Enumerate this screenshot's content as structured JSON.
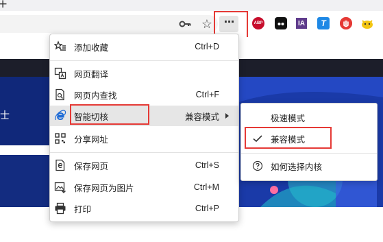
{
  "tabs": {
    "new_tab_glyph": "+"
  },
  "toolbar": {
    "icons": [
      "key-icon",
      "star-icon",
      "more-icon"
    ],
    "more_glyph": "···",
    "extensions": [
      {
        "name": "adblock-plus-icon",
        "text": "ABP"
      },
      {
        "name": "dots-extension-icon",
        "text": ""
      },
      {
        "name": "internet-archive-icon",
        "text": "IA"
      },
      {
        "name": "t-extension-icon",
        "text": "T"
      },
      {
        "name": "stop-hand-icon",
        "text": ""
      },
      {
        "name": "cow-extension-icon",
        "text": ""
      }
    ]
  },
  "page": {
    "banner_fragment": "士"
  },
  "menu": {
    "items": [
      {
        "label": "添加收藏",
        "shortcut": "Ctrl+D",
        "icon": "favorites-add-icon"
      },
      {
        "label": "网页翻译",
        "shortcut": "",
        "icon": "translate-icon"
      },
      {
        "label": "网页内查找",
        "shortcut": "Ctrl+F",
        "icon": "find-in-page-icon"
      },
      {
        "label": "智能切核",
        "shortcut": "兼容模式",
        "icon": "ie-icon"
      },
      {
        "label": "分享网址",
        "shortcut": "",
        "icon": "qr-code-icon"
      },
      {
        "label": "保存网页",
        "shortcut": "Ctrl+S",
        "icon": "save-page-icon"
      },
      {
        "label": "保存网页为图片",
        "shortcut": "Ctrl+M",
        "icon": "save-image-icon"
      },
      {
        "label": "打印",
        "shortcut": "Ctrl+P",
        "icon": "print-icon"
      }
    ]
  },
  "submenu": {
    "items": [
      {
        "label": "极速模式",
        "checked": false
      },
      {
        "label": "兼容模式",
        "checked": true
      },
      {
        "label": "如何选择内核",
        "icon": "help-icon"
      }
    ]
  },
  "colors": {
    "highlight": "#e53935",
    "banner": "#10287a",
    "dark_bar": "#1c1e2a",
    "menu_hover": "#e6e6e6"
  }
}
